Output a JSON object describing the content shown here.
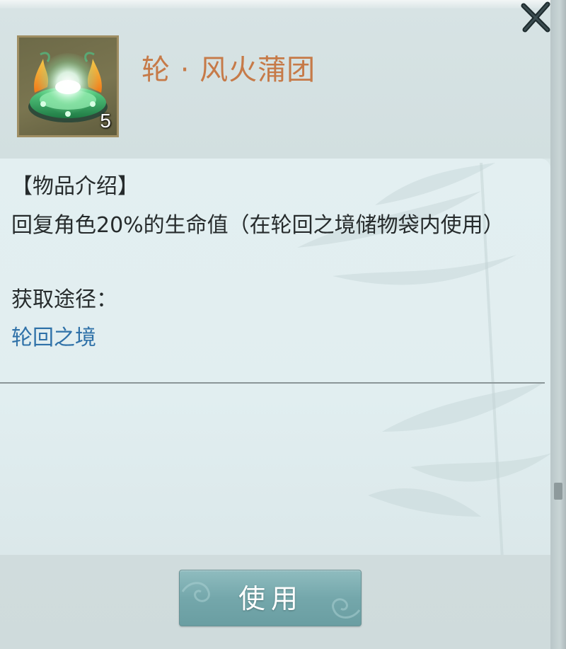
{
  "item": {
    "name": "轮 · 风火蒲团",
    "count": "5",
    "icon": "glowing-cushion-icon"
  },
  "description": {
    "heading": "【物品介绍】",
    "text": "回复角色20%的生命值（在轮回之境储物袋内使用）"
  },
  "source": {
    "label": "获取途径：",
    "link": "轮回之境"
  },
  "actions": {
    "use_label": "使用",
    "close_icon": "close-icon"
  },
  "colors": {
    "item_name": "#c67a48",
    "link": "#2f71a8",
    "button": "#74a7ab"
  }
}
